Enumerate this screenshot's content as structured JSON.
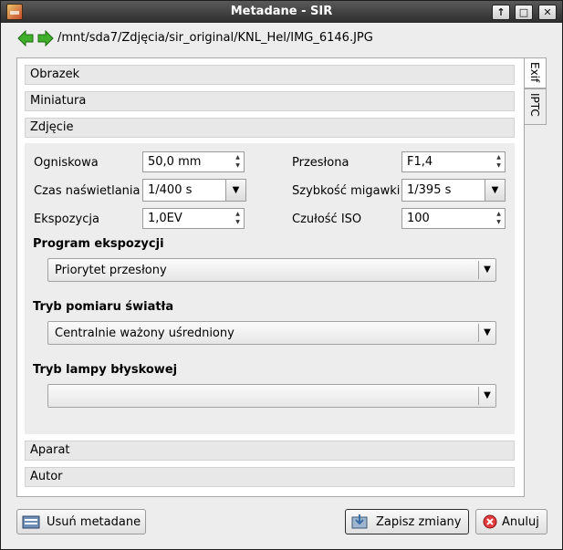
{
  "window": {
    "title": "Metadane - SIR",
    "buttons": [
      "↑",
      "□",
      "✕"
    ]
  },
  "path": "/mnt/sda7/Zdjęcia/sir_original/KNL_Hel/IMG_6146.JPG",
  "sections": {
    "obrazek": "Obrazek",
    "miniatura": "Miniatura",
    "zdjecie": "Zdjęcie",
    "aparat": "Aparat",
    "autor": "Autor"
  },
  "photo": {
    "focal_label": "Ogniskowa",
    "focal_value": "50,0 mm",
    "aperture_label": "Przesłona",
    "aperture_value": "F1,4",
    "exposure_time_label": "Czas naświetlania",
    "exposure_time_value": "1/400 s",
    "shutter_label": "Szybkość migawki",
    "shutter_value": "1/395 s",
    "exposure_label": "Ekspozycja",
    "exposure_value": "1,0EV",
    "iso_label": "Czułość ISO",
    "iso_value": "100",
    "program_title": "Program ekspozycji",
    "program_value": "Priorytet przesłony",
    "metering_title": "Tryb pomiaru światła",
    "metering_value": "Centralnie ważony uśredniony",
    "flash_title": "Tryb lampy błyskowej",
    "flash_value": ""
  },
  "tabs": {
    "exif": "Exif",
    "iptc": "IPTC"
  },
  "buttons": {
    "remove": "Usuń metadane",
    "save": "Zapisz zmiany",
    "cancel": "Anuluj"
  }
}
